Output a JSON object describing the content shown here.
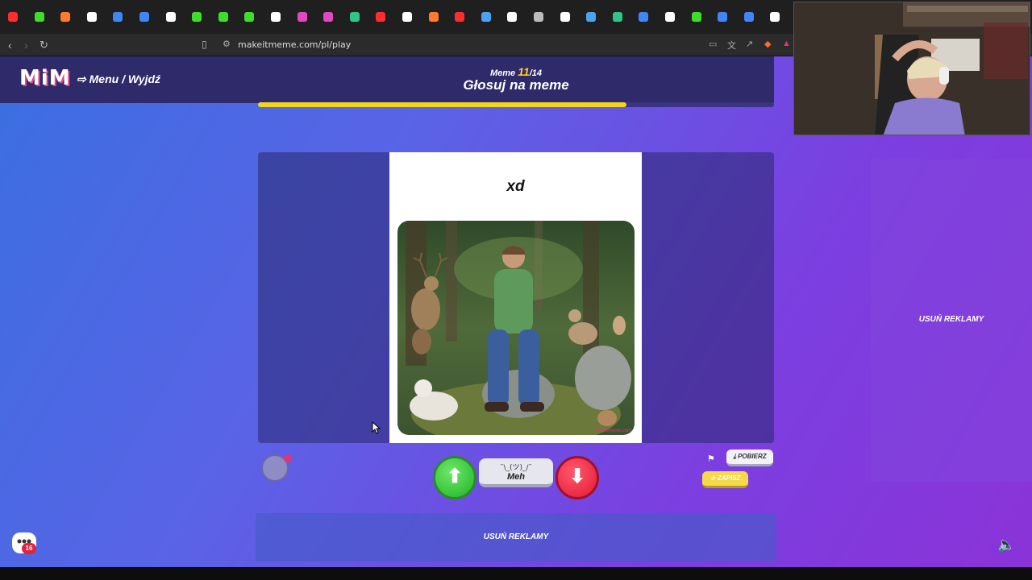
{
  "browser": {
    "url": "makeitmeme.com/pl/play",
    "tab_colors": [
      "#ff2d2d",
      "#3fdc2e",
      "#ff7a2d",
      "#ffffff",
      "#4285f4",
      "#4285f4",
      "#ffffff",
      "#3fdc2e",
      "#3fdc2e",
      "#3fdc2e",
      "#ffffff",
      "#e04ac0",
      "#e04ac0",
      "#31c489",
      "#ff2d2d",
      "#ffffff",
      "#ff7a2d",
      "#ff2d2d",
      "#4aa3f0",
      "#ffffff",
      "#bbbbbb",
      "#ffffff",
      "#4aa3f0",
      "#31c489",
      "#4285f4",
      "#ffffff",
      "#3fdc2e",
      "#4285f4",
      "#4285f4",
      "#ffffff"
    ]
  },
  "header": {
    "logo": "MiM",
    "menu_link": "Menu / Wyjdź",
    "meme_label": "Meme",
    "meme_current": "11",
    "meme_total": "/14",
    "title": "Głosuj na meme",
    "progress_fraction": 0.714
  },
  "meme": {
    "caption": "xd",
    "watermark": "makeitmeme.com"
  },
  "voting": {
    "up_icon": "arrow-up-icon",
    "meh_face": "¯\\_(ツ)_/¯",
    "meh_label": "Meh",
    "down_icon": "arrow-down-icon"
  },
  "actions": {
    "download_label": "POBIERZ",
    "save_label": "ZAPISZ"
  },
  "ads": {
    "side_label": "USUŃ REKLAMY",
    "bottom_label": "USUŃ REKLAMY"
  },
  "chat": {
    "badge_count": "16"
  },
  "colors": {
    "accent": "#f3d61c",
    "upvote": "#1fb324",
    "downvote": "#e31734",
    "header_bg": "#2f2a6a"
  }
}
